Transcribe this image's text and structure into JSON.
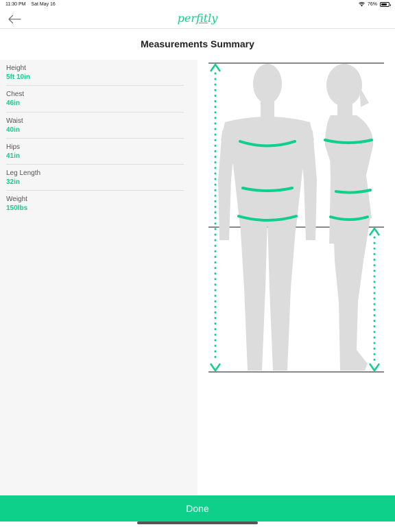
{
  "colors": {
    "accent": "#0fd08a",
    "silhouette": "#dcdcdc",
    "guide": "#888888"
  },
  "status": {
    "time": "11:30 PM",
    "date": "Sat May 16",
    "battery": "76%",
    "battery_level": 0.76
  },
  "nav": {
    "back_icon": "arrow-left-icon",
    "brand": "perfitly"
  },
  "page": {
    "title": "Measurements Summary"
  },
  "measurements": [
    {
      "label": "Height",
      "value": "5ft 10in"
    },
    {
      "label": "Chest",
      "value": "46in"
    },
    {
      "label": "Waist",
      "value": "40in"
    },
    {
      "label": "Hips",
      "value": "41in"
    },
    {
      "label": "Leg Length",
      "value": "32in"
    },
    {
      "label": "Weight",
      "value": "150lbs"
    }
  ],
  "figure": {
    "icons": [
      "front-body-silhouette",
      "side-body-silhouette",
      "height-arrow",
      "leg-length-arrow"
    ]
  },
  "footer": {
    "done_label": "Done"
  }
}
